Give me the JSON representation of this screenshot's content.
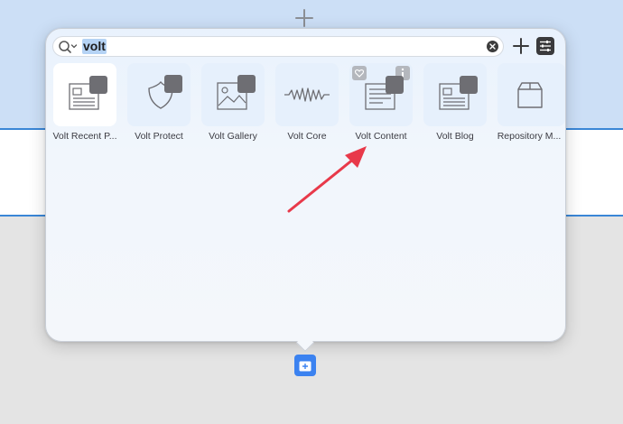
{
  "search": {
    "value": "volt",
    "placeholder": "Search"
  },
  "blocks": [
    {
      "label": "Volt Recent P...",
      "icon": "recent-posts-icon"
    },
    {
      "label": "Volt Protect",
      "icon": "shield-icon"
    },
    {
      "label": "Volt Gallery",
      "icon": "gallery-icon"
    },
    {
      "label": "Volt Core",
      "icon": "zigzag-icon"
    },
    {
      "label": "Volt Content",
      "icon": "content-icon"
    },
    {
      "label": "Volt Blog",
      "icon": "blog-icon"
    },
    {
      "label": "Repository M...",
      "icon": "box-icon"
    }
  ],
  "colors": {
    "accent": "#3b82f0",
    "arrow": "#e8394a",
    "panel": "#f4f7fb",
    "canvas_top": "#ccdff6",
    "divider": "#3a86d6"
  }
}
